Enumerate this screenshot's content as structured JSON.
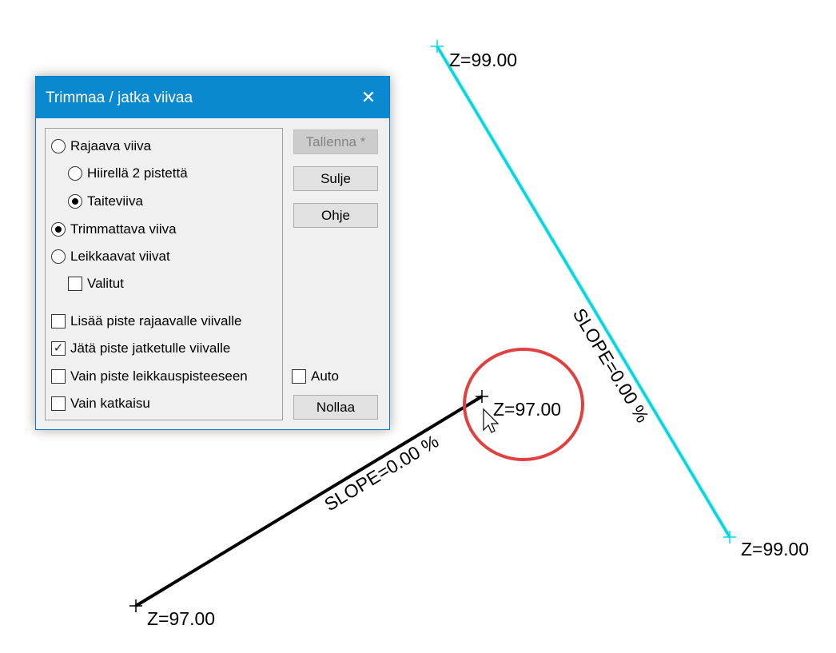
{
  "drawing": {
    "labels": {
      "top_point": "Z=99.00",
      "bottom_right_point": "Z=99.00",
      "end_point_circled": "Z=97.00",
      "start_point": "Z=97.00",
      "slope_cyan": "SLOPE=0.00 %",
      "slope_black": "SLOPE=0.00 %"
    },
    "colors": {
      "selected_line": "#00e5ee",
      "line": "#000000",
      "highlight_circle": "#e04040"
    }
  },
  "dialog": {
    "title": "Trimmaa / jatka viivaa",
    "close_icon": "close-icon",
    "options": {
      "rajaava_viiva": "Rajaava viiva",
      "hiirella_2_pistetta": "Hiirellä 2 pistettä",
      "taiteviiva": "Taiteviiva",
      "trimmattava_viiva": "Trimmattava viiva",
      "leikkaavat_viivat": "Leikkaavat viivat",
      "valitut": "Valitut"
    },
    "checkboxes": {
      "lisaa_piste": "Lisää piste rajaavalle viivalle",
      "jata_piste": "Jätä piste jatketulle viivalle",
      "vain_piste": "Vain piste leikkauspisteeseen",
      "vain_katkaisu": "Vain katkaisu",
      "auto": "Auto"
    },
    "buttons": {
      "tallenna": "Tallenna *",
      "sulje": "Sulje",
      "ohje": "Ohje",
      "nollaa": "Nollaa"
    }
  }
}
